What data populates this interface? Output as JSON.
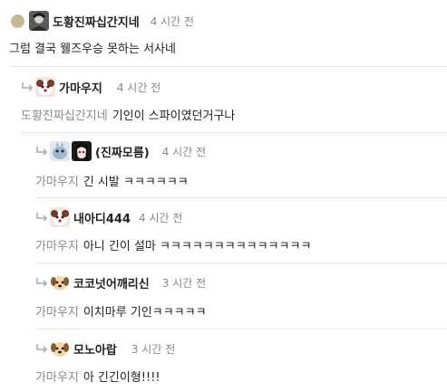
{
  "comments": [
    {
      "nick": "도황진짜십간지네",
      "time": "4 시간 전",
      "text": "그럼 결국 웰즈우승 못하는 서사네",
      "mention": ""
    },
    {
      "nick": "가마우지",
      "time": "4 시간 전",
      "mention": "도황진짜십간지네",
      "text": "기인이 스파이였던거구나"
    },
    {
      "nick": "(진짜모름)",
      "time": "4 시간 전",
      "mention": "가마우지",
      "text": "긴 시발 ㅋㅋㅋㅋㅋㅋ"
    },
    {
      "nick": "내아디444",
      "time": "4 시간 전",
      "mention": "가마우지",
      "text": "아니 긴이 설마 ㅋㅋㅋㅋㅋㅋㅋㅋㅋㅋㅋㅋㅋㅋ"
    },
    {
      "nick": "코코넛어깨리신",
      "time": "3 시간 전",
      "mention": "가마우지",
      "text": "이치마루 기인ㅋㅋㅋㅋㅋ"
    },
    {
      "nick": "모노아랍",
      "time": "3 시간 전",
      "mention": "가마우지",
      "text": "아 긴긴이형!!!!"
    }
  ],
  "colors": {
    "mention": "#8a8a8a",
    "time": "#888888",
    "divider": "#e6e6e6"
  }
}
